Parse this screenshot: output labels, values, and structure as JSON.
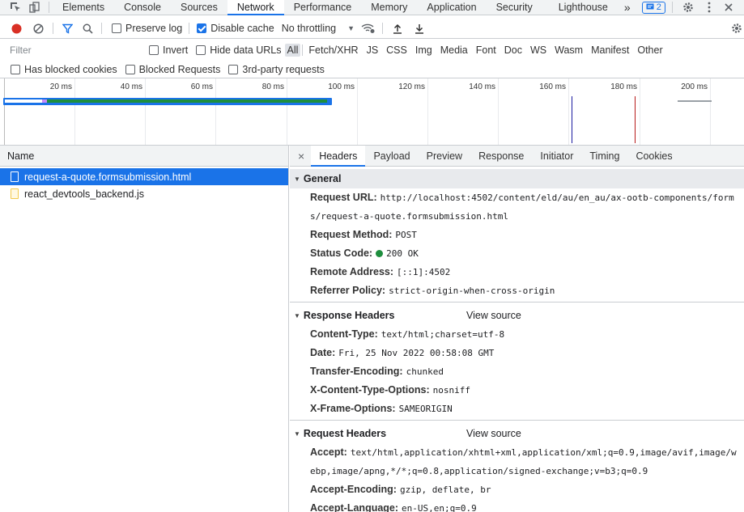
{
  "topbar": {
    "tabs": [
      "Elements",
      "Console",
      "Sources",
      "Network",
      "Performance",
      "Memory",
      "Application",
      "Security",
      "Lighthouse"
    ],
    "active_tab": "Network",
    "more": "»",
    "issues_count": "2"
  },
  "toolbar": {
    "preserve_log": "Preserve log",
    "disable_cache": "Disable cache",
    "throttling": "No throttling",
    "dropdown_arrow": "▼"
  },
  "filter": {
    "placeholder": "Filter",
    "invert": "Invert",
    "hide_data_urls": "Hide data URLs",
    "types": [
      "All",
      "Fetch/XHR",
      "JS",
      "CSS",
      "Img",
      "Media",
      "Font",
      "Doc",
      "WS",
      "Wasm",
      "Manifest",
      "Other"
    ]
  },
  "blocked": {
    "has_blocked_cookies": "Has blocked cookies",
    "blocked_requests": "Blocked Requests",
    "third_party": "3rd-party requests"
  },
  "overview": {
    "ticks": [
      "20 ms",
      "40 ms",
      "60 ms",
      "80 ms",
      "100 ms",
      "120 ms",
      "140 ms",
      "160 ms",
      "180 ms",
      "200 ms"
    ]
  },
  "requests": {
    "column": "Name",
    "items": [
      "request-a-quote.formsubmission.html",
      "react_devtools_backend.js"
    ]
  },
  "details": {
    "close": "×",
    "tabs": [
      "Headers",
      "Payload",
      "Preview",
      "Response",
      "Initiator",
      "Timing",
      "Cookies"
    ],
    "general": {
      "title": "General",
      "request_url_key": "Request URL:",
      "request_url": "http://localhost:4502/content/eld/au/en_au/ax-ootb-components/forms/request-a-quote.formsubmission.html",
      "method_key": "Request Method:",
      "method": "POST",
      "status_key": "Status Code:",
      "status": "200 OK",
      "remote_key": "Remote Address:",
      "remote": "[::1]:4502",
      "referrer_key": "Referrer Policy:",
      "referrer": "strict-origin-when-cross-origin"
    },
    "response_headers": {
      "title": "Response Headers",
      "view_source": "View source",
      "items": [
        {
          "k": "Content-Type:",
          "v": "text/html;charset=utf-8"
        },
        {
          "k": "Date:",
          "v": "Fri, 25 Nov 2022 00:58:08 GMT"
        },
        {
          "k": "Transfer-Encoding:",
          "v": "chunked"
        },
        {
          "k": "X-Content-Type-Options:",
          "v": "nosniff"
        },
        {
          "k": "X-Frame-Options:",
          "v": "SAMEORIGIN"
        }
      ]
    },
    "request_headers": {
      "title": "Request Headers",
      "view_source": "View source",
      "items": [
        {
          "k": "Accept:",
          "v": "text/html,application/xhtml+xml,application/xml;q=0.9,image/avif,image/webp,image/apng,*/*;q=0.8,application/signed-exchange;v=b3;q=0.9"
        },
        {
          "k": "Accept-Encoding:",
          "v": "gzip, deflate, br"
        },
        {
          "k": "Accept-Language:",
          "v": "en-US,en;q=0.9"
        }
      ]
    }
  },
  "colors": {
    "accent": "#1a73e8",
    "record": "#d93025",
    "status_ok": "#1e8e3e"
  }
}
